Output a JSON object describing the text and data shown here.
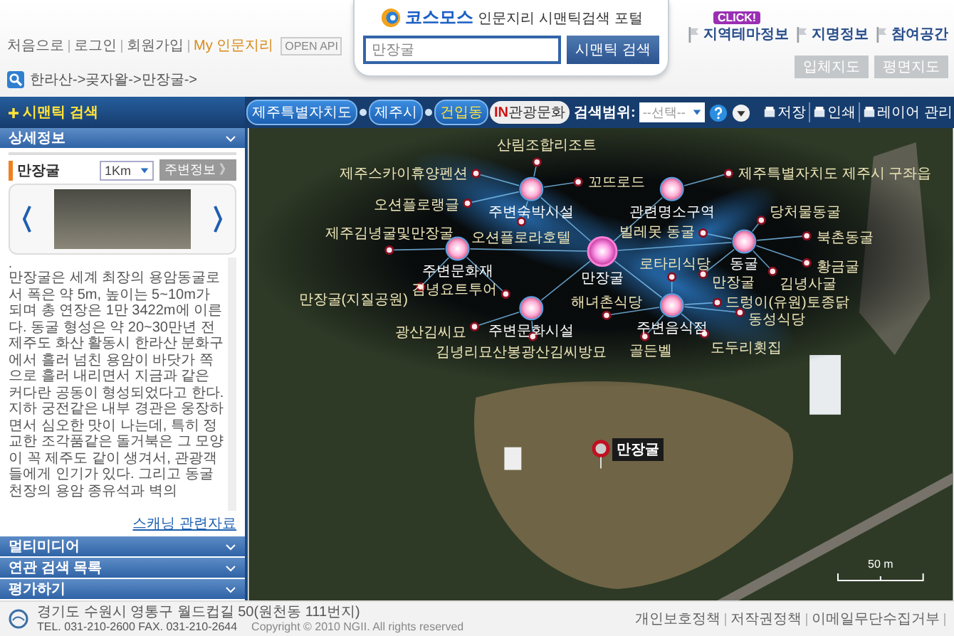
{
  "header": {
    "top_links": [
      "처음으로",
      "로그인",
      "회원가입"
    ],
    "my_link": "My 인문지리",
    "open_api": "OPEN API",
    "logo": {
      "name": "코스모스",
      "tagline": "인문지리 시맨틱검색 포털"
    },
    "search": {
      "value": "만장굴",
      "button": "시맨틱 검색"
    },
    "nav": [
      {
        "label": "지역테마정보",
        "badge": "CLICK!"
      },
      {
        "label": "지명정보"
      },
      {
        "label": "참여공간"
      }
    ],
    "breadcrumb": "한라산->곶자왈->만장굴->",
    "map_modes": [
      "입체지도",
      "평면지도"
    ]
  },
  "sidebar": {
    "title": "시맨틱 검색",
    "detail": {
      "title": "상세정보",
      "place": "만장굴",
      "radius": "1Km",
      "nearby_button": "주변정보 》",
      "lead": ".",
      "description": "만장굴은 세계 최장의 용암동굴로서 폭은 약 5m, 높이는 5~10m가 되며 총 연장은 1만 3422m에 이른다. 동굴 형성은 약 20~30만년 전 제주도 화산 활동시 한라산 분화구에서 흘러 넘친 용암이 바닷가 쪽으로 흘러 내리면서 지금과 같은 커다란 공동이 형성되었다고 한다. 지하 궁전같은 내부 경관은 웅장하면서 심오한 맛이 나는데, 특히 정교한 조각품같은 돌거북은 그 모양이 꼭 제주도 같이 생겨서, 관광객들에게 인기가 있다. 그리고 동굴 천장의 용암 종유석과 벽의",
      "link": "스캐닝 관련자료"
    },
    "sections": [
      "멀티미디어",
      "연관 검색 목록",
      "평가하기"
    ]
  },
  "map": {
    "tabs": [
      {
        "label": "제주특별자치도",
        "selected": false
      },
      {
        "label": "제주시",
        "selected": false
      },
      {
        "label": "건입동",
        "selected": true
      }
    ],
    "theme_badge": {
      "prefix": "IN",
      "label": "관광문화"
    },
    "scope_label": "검색범위:",
    "scope_select": "--선택--",
    "tools": [
      "저장",
      "인쇄",
      "레이어 관리"
    ],
    "hub": "만장굴",
    "categories": [
      {
        "label": "주변숙박시설",
        "places": [
          "산림조합리조트",
          "제주스카이휴양펜션",
          "꼬뜨로드",
          "오션플로랭글",
          "오션플로라호텔"
        ]
      },
      {
        "label": "관련명소구역",
        "places": [
          "제주특별자치도 제주시 구좌읍"
        ]
      },
      {
        "label": "주변문화재",
        "places": [
          "제주김녕굴및만장굴",
          "만장굴(지질공원)",
          "김녕요트투어"
        ]
      },
      {
        "label": "동굴",
        "places": [
          "당처물동굴",
          "빌레못 동굴",
          "북촌동굴",
          "황금굴",
          "김녕사굴",
          "만장굴"
        ]
      },
      {
        "label": "주변문화시설",
        "places": [
          "광산김씨묘",
          "김녕리묘산봉광산김씨방묘"
        ]
      },
      {
        "label": "주변음식점",
        "places": [
          "로타리식당",
          "해녀촌식당",
          "드렁이(유원)토종닭",
          "동성식당",
          "골든벨",
          "도두리횟집"
        ]
      }
    ],
    "marker": "만장굴",
    "scale": "50 m"
  },
  "footer": {
    "address": "경기도 수원시 영통구 월드컵길 50(원천동 111번지)",
    "contact": "TEL. 031-210-2600  FAX. 031-210-2644",
    "copyright": "Copyright © 2010 NGII. All rights reserved",
    "links": [
      "개인보호정책",
      "저작권정책",
      "이메일무단수집거부"
    ]
  }
}
